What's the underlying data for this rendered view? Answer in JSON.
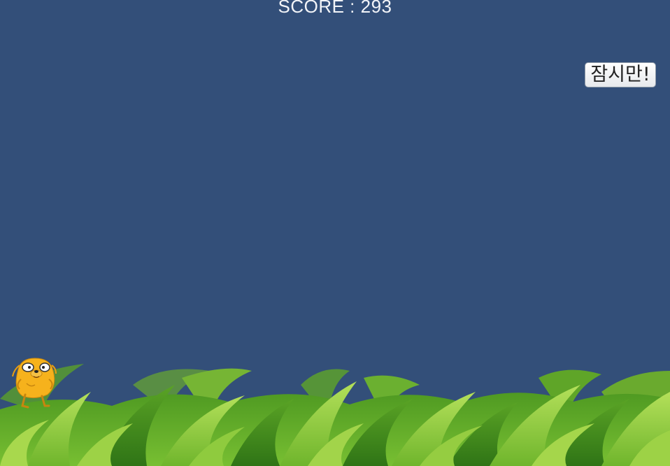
{
  "hud": {
    "score_text": "SCORE : 293",
    "pause_label": "잠시만!"
  },
  "colors": {
    "sky": "#334f79",
    "grass_dark": "#3d8a1d",
    "grass_mid": "#63ad2a",
    "grass_light": "#a5d64a",
    "character": "#f6b21c"
  },
  "icons": {
    "player": "jake-dog-character-icon",
    "ground": "grass-ground"
  }
}
